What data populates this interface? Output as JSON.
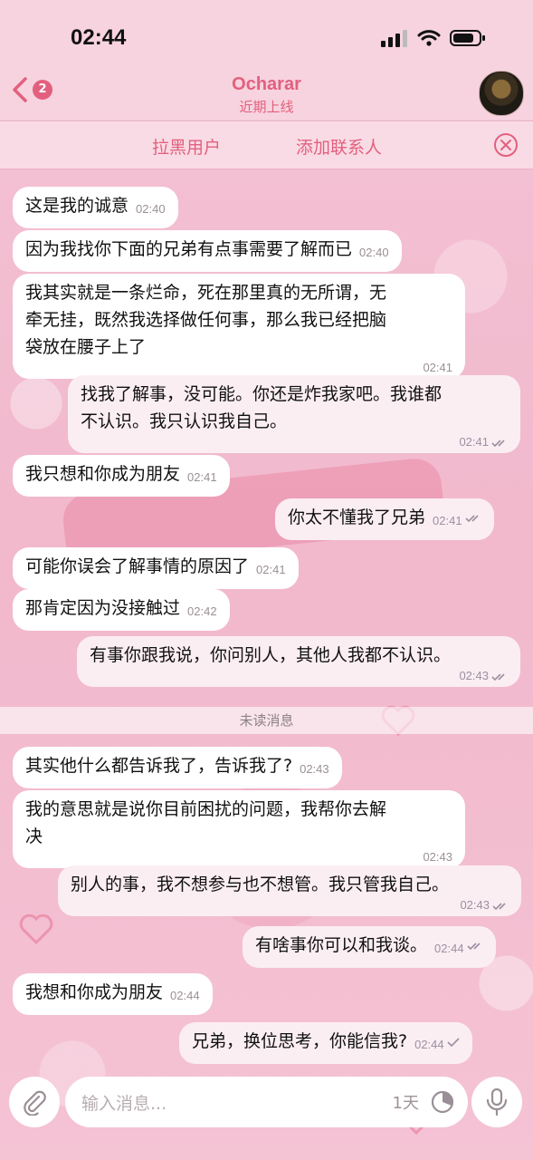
{
  "status": {
    "time": "02:44"
  },
  "header": {
    "back_badge": "2",
    "title": "Ocharar",
    "subtitle": "近期上线"
  },
  "actions": {
    "block": "拉黑用户",
    "add_contact": "添加联系人"
  },
  "messages": [
    {
      "text": "这是我的诚意",
      "time": "02:40",
      "dir": "in"
    },
    {
      "text": "因为我找你下面的兄弟有点事需要了解而已",
      "time": "02:40",
      "dir": "in"
    },
    {
      "lines": [
        "我其实就是一条烂命，死在那里真的无所谓，无",
        "牵无挂，既然我选择做任何事，那么我已经把脑",
        "袋放在腰子上了"
      ],
      "time": "02:41",
      "dir": "in"
    },
    {
      "lines": [
        "找我了解事，没可能。你还是炸我家吧。我谁都",
        "不认识。我只认识我自己。"
      ],
      "time": "02:41",
      "dir": "out"
    },
    {
      "text": "我只想和你成为朋友",
      "time": "02:41",
      "dir": "in"
    },
    {
      "text": "你太不懂我了兄弟",
      "time": "02:41",
      "dir": "out"
    },
    {
      "text": "可能你误会了解事情的原因了",
      "time": "02:41",
      "dir": "in"
    },
    {
      "text": "那肯定因为没接触过",
      "time": "02:42",
      "dir": "in"
    },
    {
      "text": "有事你跟我说，你问别人，其他人我都不认识。",
      "time": "02:43",
      "dir": "out"
    },
    {
      "text": "其实他什么都告诉我了，告诉我了?",
      "time": "02:43",
      "dir": "in"
    },
    {
      "lines": [
        "我的意思就是说你目前困扰的问题，我帮你去解",
        "决"
      ],
      "time": "02:43",
      "dir": "in"
    },
    {
      "text": "别人的事，我不想参与也不想管。我只管我自己。",
      "time": "02:43",
      "dir": "out"
    },
    {
      "text": "有啥事你可以和我谈。",
      "time": "02:44",
      "dir": "out"
    },
    {
      "text": "我想和你成为朋友",
      "time": "02:44",
      "dir": "in"
    },
    {
      "text": "兄弟，换位思考，你能信我?",
      "time": "02:44",
      "dir": "out"
    }
  ],
  "unread_label": "未读消息",
  "input": {
    "placeholder": "输入消息...",
    "timer_label": "1天"
  },
  "colors": {
    "accent": "#e2607e",
    "incoming_bubble": "#ffffff",
    "outgoing_bubble": "#fbeef3"
  }
}
